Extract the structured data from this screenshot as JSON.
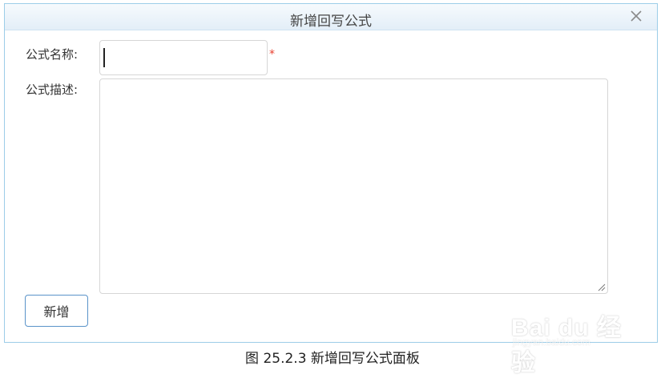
{
  "dialog": {
    "title": "新增回写公式",
    "close_icon": "close-icon"
  },
  "form": {
    "name_label": "公式名称:",
    "name_value": "",
    "required_mark": "*",
    "desc_label": "公式描述:",
    "desc_value": ""
  },
  "actions": {
    "add_label": "新增"
  },
  "watermark": {
    "text": "Bai du 经验",
    "subtext": "jingyan.baidu.com"
  },
  "caption": "图 25.2.3  新增回写公式面板",
  "colors": {
    "border": "#9ccde8",
    "required": "#e8402f",
    "button_border": "#5a93c9"
  }
}
